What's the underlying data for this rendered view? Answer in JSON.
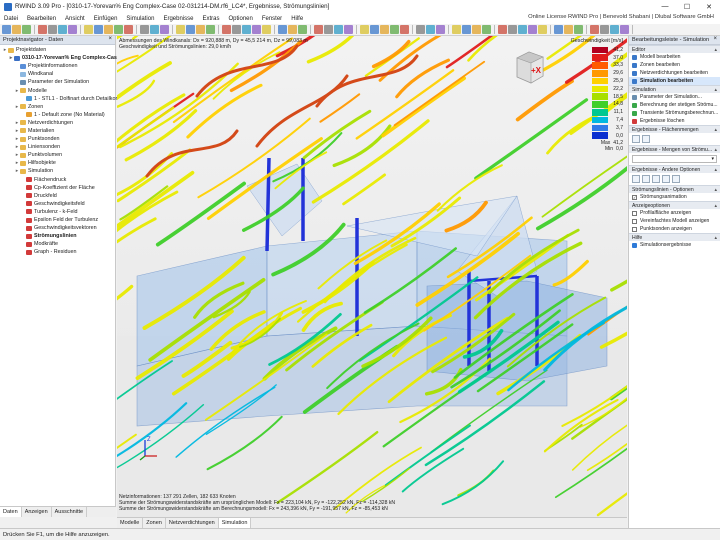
{
  "window": {
    "title": "RWIND 3.09 Pro - [0310-17-Yorevan% Eng Complex-Case 02-031214-DM.rf6_LC4*, Ergebnisse, Strömungslinien]",
    "license": "Online License RWIND Pro | Benevold Shabani | Dlubal Software GmbH"
  },
  "menu": [
    "Datei",
    "Bearbeiten",
    "Ansicht",
    "Einfügen",
    "Simulation",
    "Ergebnisse",
    "Extras",
    "Optionen",
    "Fenster",
    "Hilfe"
  ],
  "navigator": {
    "title": "Projektnavigator - Daten",
    "tree": [
      {
        "label": "Projektdaten",
        "depth": 0,
        "icon": "folder-icon",
        "bold": false
      },
      {
        "label": "0310-17-Yorevan% Eng Complex-Case",
        "depth": 1,
        "icon": "model-icon",
        "bold": true
      },
      {
        "label": "Projektinformationen",
        "depth": 2,
        "icon": "info-icon",
        "bold": false
      },
      {
        "label": "Windkanal",
        "depth": 2,
        "icon": "tunnel-icon",
        "bold": false
      },
      {
        "label": "Parameter der Simulation",
        "depth": 2,
        "icon": "param-icon",
        "bold": false
      },
      {
        "label": "Modelle",
        "depth": 2,
        "icon": "folder-icon",
        "bold": false
      },
      {
        "label": "1 - STL1 - Dolfinart durch Detailkorr",
        "depth": 3,
        "icon": "mesh-icon",
        "bold": false
      },
      {
        "label": "Zonen",
        "depth": 2,
        "icon": "folder-icon",
        "bold": false
      },
      {
        "label": "1 - Default zone (No Material)",
        "depth": 3,
        "icon": "zone-icon",
        "bold": false
      },
      {
        "label": "Netzverdichtungen",
        "depth": 2,
        "icon": "folder-icon",
        "bold": false
      },
      {
        "label": "Materialien",
        "depth": 2,
        "icon": "folder-icon",
        "bold": false
      },
      {
        "label": "Punktsonden",
        "depth": 2,
        "icon": "folder-icon",
        "bold": false
      },
      {
        "label": "Liniensonden",
        "depth": 2,
        "icon": "folder-icon",
        "bold": false
      },
      {
        "label": "Punktvolumen",
        "depth": 2,
        "icon": "folder-icon",
        "bold": false
      },
      {
        "label": "Hilfsobjekte",
        "depth": 2,
        "icon": "folder-icon",
        "bold": false
      },
      {
        "label": "Simulation",
        "depth": 2,
        "icon": "folder-icon",
        "bold": false
      },
      {
        "label": "Flächendruck",
        "depth": 3,
        "icon": "result-icon",
        "bold": false
      },
      {
        "label": "Cp-Koeffizient der Fläche",
        "depth": 3,
        "icon": "result-icon",
        "bold": false
      },
      {
        "label": "Druckfeld",
        "depth": 3,
        "icon": "result-icon",
        "bold": false
      },
      {
        "label": "Geschwindigkeitsfeld",
        "depth": 3,
        "icon": "result-icon",
        "bold": false
      },
      {
        "label": "Turbulenz - k-Feld",
        "depth": 3,
        "icon": "result-icon",
        "bold": false
      },
      {
        "label": "Epsilon Feld der Turbulenz",
        "depth": 3,
        "icon": "result-icon",
        "bold": false
      },
      {
        "label": "Geschwindigkeitsvektoren",
        "depth": 3,
        "icon": "result-icon",
        "bold": false
      },
      {
        "label": "Strömungslinien",
        "depth": 3,
        "icon": "result-icon",
        "bold": true
      },
      {
        "label": "Modkräfte",
        "depth": 3,
        "icon": "result-icon",
        "bold": false
      },
      {
        "label": "Graph - Residuen",
        "depth": 3,
        "icon": "result-icon",
        "bold": false
      }
    ],
    "tabs": [
      "Daten",
      "Anzeigen",
      "Ausschnitte"
    ]
  },
  "viewport": {
    "info_lines": [
      "Abmessungen des Windkanals: Dx = 920,888 m, Dy = 45,5 214 m, Dz = 99,083 m",
      "Geschwindigkeit und Strömungslinien: 29,0 km/h"
    ],
    "footer_lines": [
      "Netzinformationen: 137 291 Zellen, 182 633 Knoten",
      "Summe der Strömungswiderstandskräfte am ursprünglichen Modell: Fx = 223,104 kN, Fy = -122,252 kN, Fz = -114,328 kN",
      "Summe der Strömungswiderstandskräfte am Berechnungsmodell: Fx = 243,396 kN, Fy = -191,957 kN, Fz = -85,453 kN"
    ],
    "viewcube_label": "+X",
    "axis_label": "Z"
  },
  "legend": {
    "title": "Geschwindigkeit [m/s]",
    "entries": [
      {
        "value": "41,2",
        "color": "#b3001f"
      },
      {
        "value": "37,0",
        "color": "#e01c1c"
      },
      {
        "value": "33,3",
        "color": "#ff5a00"
      },
      {
        "value": "29,6",
        "color": "#ff9900"
      },
      {
        "value": "25,9",
        "color": "#ffd000"
      },
      {
        "value": "22,2",
        "color": "#e8ea00"
      },
      {
        "value": "18,5",
        "color": "#a8df00"
      },
      {
        "value": "14,8",
        "color": "#3fcf2a"
      },
      {
        "value": "11,1",
        "color": "#00c890"
      },
      {
        "value": "7,4",
        "color": "#00b8e0"
      },
      {
        "value": "3,7",
        "color": "#2f7ae8"
      },
      {
        "value": "0,0",
        "color": "#0a2fd0"
      }
    ],
    "max_label": "Max",
    "max_value": "41,2",
    "min_label": "Min",
    "min_value": "0,0"
  },
  "view_tabs": [
    "Modelle",
    "Zonen",
    "Netzverdichtungen",
    "Simulation"
  ],
  "right_panel": {
    "title": "Bearbeitungsleiste - Simulation",
    "sections": [
      {
        "title": "Editor",
        "type": "list",
        "items": [
          {
            "label": "Modell bearbeiten",
            "icon": "edit-icon",
            "bold": false
          },
          {
            "label": "Zonen bearbeiten",
            "icon": "edit-icon",
            "bold": false
          },
          {
            "label": "Netzverdichtungen bearbeiten",
            "icon": "edit-icon",
            "bold": false
          },
          {
            "label": "Simulation bearbeiten",
            "icon": "edit-icon",
            "bold": true
          }
        ]
      },
      {
        "title": "Simulation",
        "type": "list",
        "items": [
          {
            "label": "Parameter der Simulation...",
            "icon": "param-icon",
            "bold": false
          },
          {
            "label": "Berechnung der stetigen Strömu...",
            "icon": "run-icon",
            "bold": false
          },
          {
            "label": "Transiente Strömungsberechnun...",
            "icon": "run-icon",
            "bold": false
          },
          {
            "label": "Ergebnisse löschen",
            "icon": "delete-icon",
            "bold": false
          }
        ]
      },
      {
        "title": "Ergebnisse - Flächenmengen",
        "type": "icons",
        "count": 2
      },
      {
        "title": "Ergebnisse - Mengen von Strömu...",
        "type": "select",
        "value": ""
      },
      {
        "title": "Ergebnisse - Andere Optionen",
        "type": "icons",
        "count": 5
      },
      {
        "title": "Strömungslinien - Optionen",
        "type": "checks",
        "items": [
          {
            "label": "Strömungsanimation",
            "checked": true
          }
        ]
      },
      {
        "title": "Anzeigeoptionen",
        "type": "checks",
        "items": [
          {
            "label": "Profilalfläche anzeigen",
            "checked": false
          },
          {
            "label": "Vereinfachtes Modell anzeigen",
            "checked": false
          },
          {
            "label": "Punktsonden anzeigen",
            "checked": false
          }
        ]
      },
      {
        "title": "Hilfe",
        "type": "list",
        "items": [
          {
            "label": "Simulationsergebnisse",
            "icon": "help-icon",
            "bold": false
          }
        ]
      }
    ]
  },
  "status": "Drücken Sie F1, um die Hilfe anzuzeigen."
}
